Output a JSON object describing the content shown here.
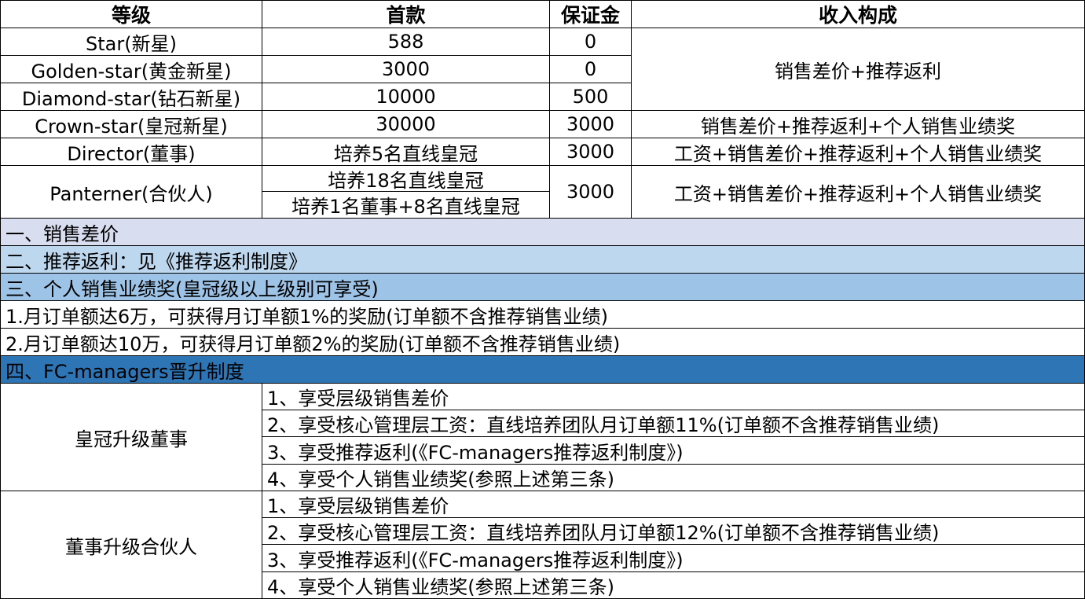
{
  "header": {
    "level": "等级",
    "down_payment": "首款",
    "deposit": "保证金",
    "income": "收入构成"
  },
  "tiers": [
    {
      "name": "Star(新星)",
      "down_payment": "588",
      "deposit": "0"
    },
    {
      "name": "Golden-star(黄金新星)",
      "down_payment": "3000",
      "deposit": "0"
    },
    {
      "name": "Diamond-star(钻石新星)",
      "down_payment": "10000",
      "deposit": "500"
    },
    {
      "name": "Crown-star(皇冠新星)",
      "down_payment": "30000",
      "deposit": "3000"
    },
    {
      "name": "Director(董事)",
      "down_payment": "培养5名直线皇冠",
      "deposit": "3000"
    },
    {
      "name": "Panterner(合伙人)",
      "down_payment_a": "培养18名直线皇冠",
      "down_payment_b": "培养1名董事+8名直线皇冠",
      "deposit": "3000"
    }
  ],
  "income": {
    "first_three": "销售差价+推荐返利",
    "crown": "销售差价+推荐返利+个人销售业绩奖",
    "director": "工资+销售差价+推荐返利+个人销售业绩奖",
    "partner": "工资+销售差价+推荐返利+个人销售业绩奖"
  },
  "sections": {
    "s1": "一、销售差价",
    "s2": "二、推荐返利：见《推荐返利制度》",
    "s3": "三、个人销售业绩奖(皇冠级以上级别可享受)",
    "s3_items": [
      "1.月订单额达6万，可获得月订单额1%的奖励(订单额不含推荐销售业绩)",
      "2.月订单额达10万，可获得月订单额2%的奖励(订单额不含推荐销售业绩)"
    ],
    "s4": "四、FC-managers晋升制度"
  },
  "promotions": [
    {
      "title": "皇冠升级董事",
      "items": [
        "1、享受层级销售差价",
        "2、享受核心管理层工资：直线培养团队月订单额11%(订单额不含推荐销售业绩)",
        "3、享受推荐返利(《FC-managers推荐返利制度》)",
        "4、享受个人销售业绩奖(参照上述第三条)"
      ]
    },
    {
      "title": "董事升级合伙人",
      "items": [
        "1、享受层级销售差价",
        "2、享受核心管理层工资：直线培养团队月订单额12%(订单额不含推荐销售业绩)",
        "3、享受推荐返利(《FC-managers推荐返利制度》)",
        "4、享受个人销售业绩奖(参照上述第三条)"
      ]
    }
  ]
}
